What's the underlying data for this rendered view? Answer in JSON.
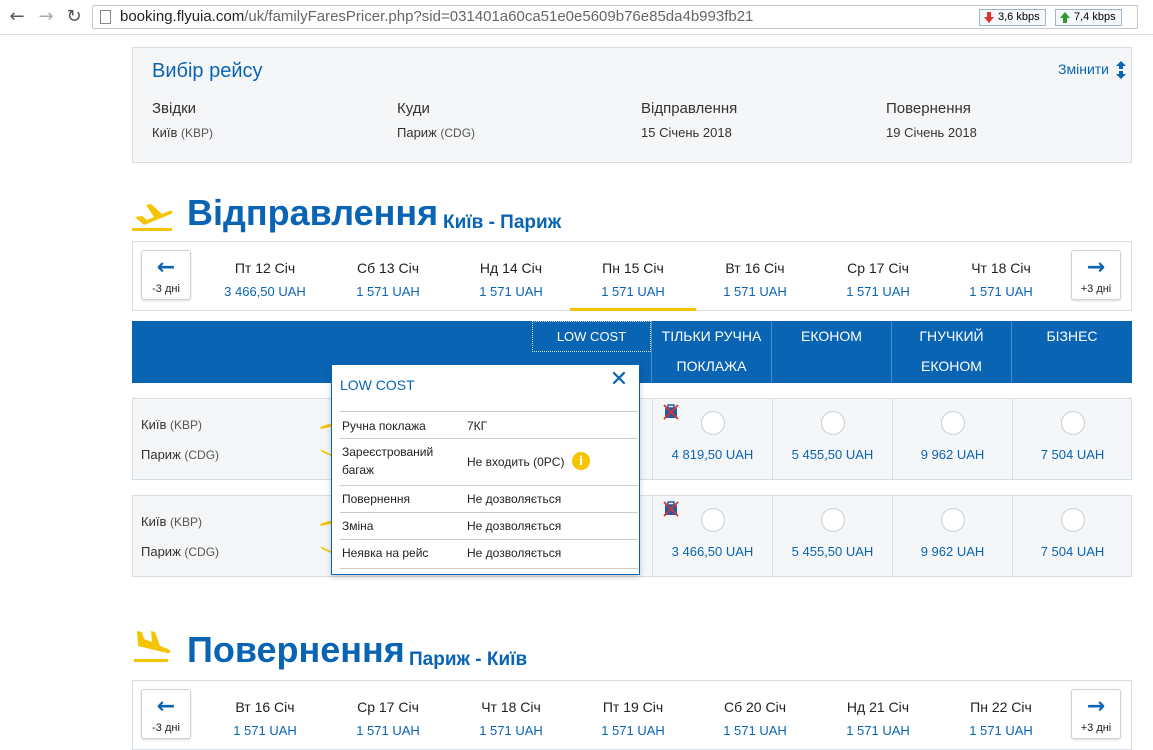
{
  "browser": {
    "url_host": "booking.flyuia.com",
    "url_path": "/uk/familyFaresPricer.php?sid=031401a60ca51e0e5609b76e85da4b993fb21",
    "speed_down": "3,6 kbps",
    "speed_up": "7,4 kbps"
  },
  "selection": {
    "title": "Вибір рейсу",
    "change_label": "Змінити",
    "from_label": "Звідки",
    "from_city": "Київ",
    "from_code": "(KBP)",
    "to_label": "Куди",
    "to_city": "Париж",
    "to_code": "(CDG)",
    "departure_label": "Відправлення",
    "departure_date": "15 Січень 2018",
    "return_label": "Повернення",
    "return_date": "19 Січень 2018"
  },
  "outbound": {
    "title": "Відправлення",
    "route": "Київ - Париж",
    "prev_label": "-3 дні",
    "next_label": "+3 дні",
    "dates": [
      {
        "day": "Пт 12 Січ",
        "price": "3 466,50 UAH"
      },
      {
        "day": "Сб 13 Січ",
        "price": "1 571 UAH"
      },
      {
        "day": "Нд 14 Січ",
        "price": "1 571 UAH"
      },
      {
        "day": "Пн 15 Січ",
        "price": "1 571 UAH"
      },
      {
        "day": "Вт 16 Січ",
        "price": "1 571 UAH"
      },
      {
        "day": "Ср 17 Січ",
        "price": "1 571 UAH"
      },
      {
        "day": "Чт 18 Січ",
        "price": "1 571 UAH"
      }
    ],
    "active_index": 3
  },
  "fares": {
    "low_cost": "LOW COST",
    "hand_luggage_1": "ТІЛЬКИ РУЧНА",
    "hand_luggage_2": "ПОКЛАЖА",
    "economy": "ЕКОНОМ",
    "flexible_1": "ГНУЧКИЙ",
    "flexible_2": "ЕКОНОМ",
    "business": "БІЗНЕС"
  },
  "flights": [
    {
      "from_city": "Київ",
      "from_code": "(KBP)",
      "to_city": "Париж",
      "to_code": "(CDG)",
      "prices": [
        "4 819,50 UAH",
        "5 455,50 UAH",
        "9 962 UAH",
        "7 504 UAH"
      ]
    },
    {
      "from_city": "Київ",
      "from_code": "(KBP)",
      "to_city": "Париж",
      "to_code": "(CDG)",
      "prices": [
        "3 466,50 UAH",
        "5 455,50 UAH",
        "9 962 UAH",
        "7 504 UAH"
      ]
    }
  ],
  "popup": {
    "title": "LOW COST",
    "rows": [
      {
        "key": "Ручна поклажа",
        "value": "7КГ"
      },
      {
        "key_1": "Зареєстрований",
        "key_2": "багаж",
        "value": "Не входить (0PC)"
      },
      {
        "key": "Повернення",
        "value": "Не дозволяється"
      },
      {
        "key": "Зміна",
        "value": "Не дозволяється"
      },
      {
        "key": "Неявка на рейс",
        "value": "Не дозволяється"
      }
    ],
    "info_badge": "i"
  },
  "inbound": {
    "title": "Повернення",
    "route": "Париж - Київ",
    "prev_label": "-3 дні",
    "next_label": "+3 дні",
    "dates": [
      {
        "day": "Вт 16 Січ",
        "price": "1 571 UAH"
      },
      {
        "day": "Ср 17 Січ",
        "price": "1 571 UAH"
      },
      {
        "day": "Чт 18 Січ",
        "price": "1 571 UAH"
      },
      {
        "day": "Пт 19 Січ",
        "price": "1 571 UAH"
      },
      {
        "day": "Сб 20 Січ",
        "price": "1 571 UAH"
      },
      {
        "day": "Нд 21 Січ",
        "price": "1 571 UAH"
      },
      {
        "day": "Пн 22 Січ",
        "price": "1 571 UAH"
      }
    ]
  },
  "colors": {
    "brand_blue": "#0a64b4",
    "accent_yellow": "#f5c400"
  }
}
